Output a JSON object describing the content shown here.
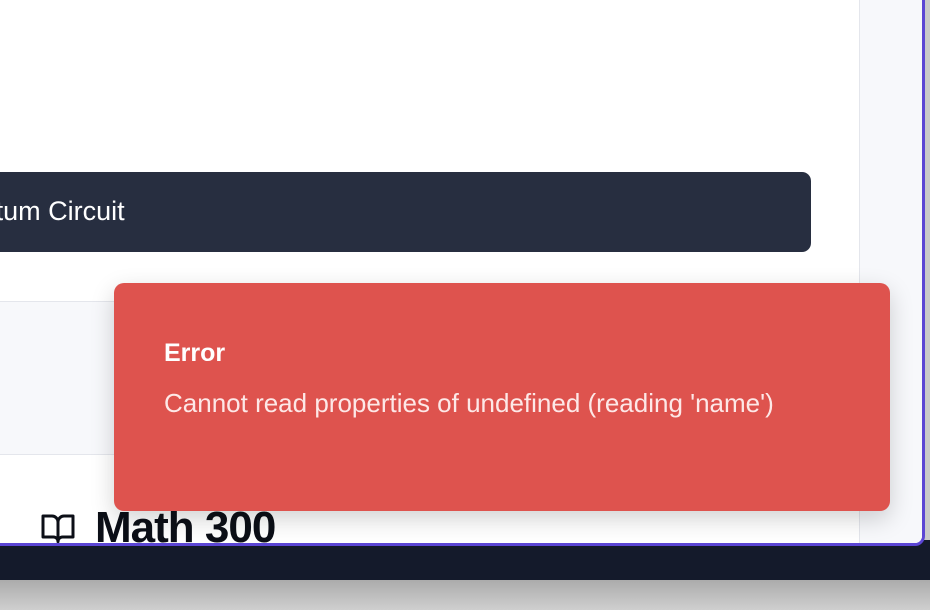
{
  "course_list": {
    "active_course_label": "Intro to Quantum Circuit",
    "next_course_title": "Math 300"
  },
  "toast": {
    "title": "Error",
    "message": "Cannot read properties of undefined (reading 'name')"
  },
  "colors": {
    "accent_border": "#5b45d4",
    "button_dark": "#272e40",
    "toast_error": "#de534e"
  },
  "icons": {
    "course_icon": "book-open-icon"
  }
}
